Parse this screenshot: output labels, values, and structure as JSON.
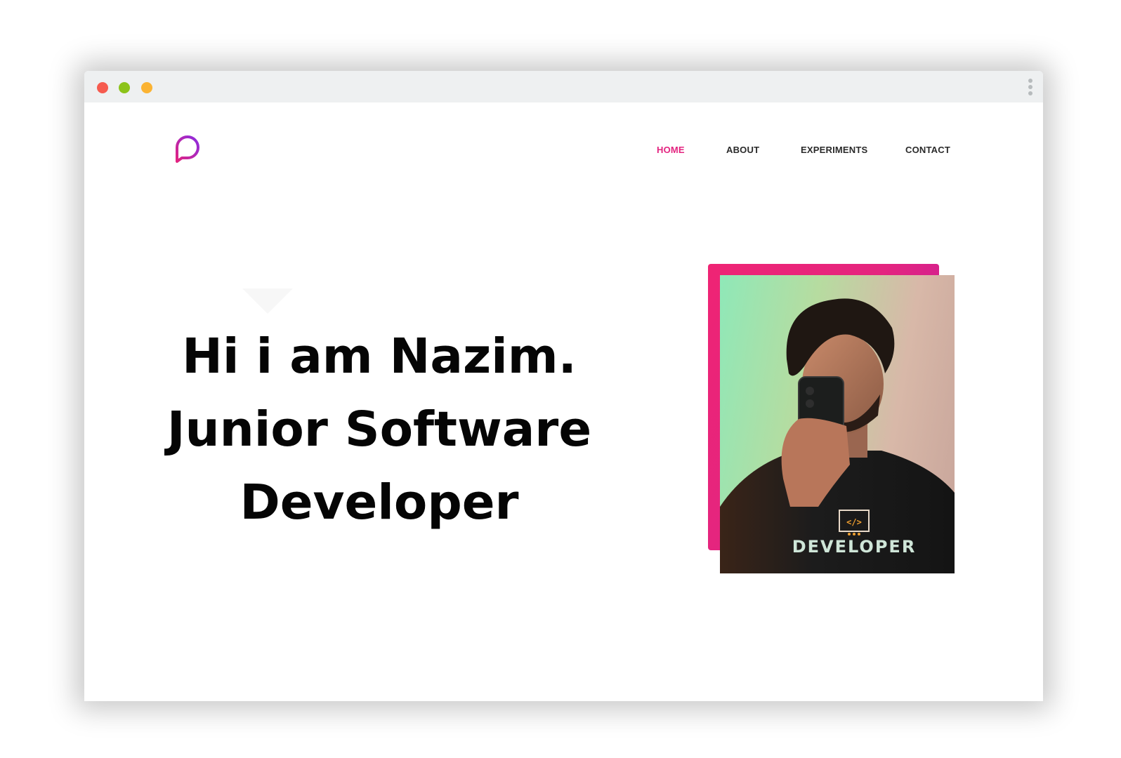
{
  "window": {
    "controls": [
      "close",
      "minimize",
      "maximize"
    ],
    "menu_icon": "kebab-menu-icon"
  },
  "brand": {
    "logo_icon": "speech-bubble-logo-icon",
    "logo_colors": [
      "#e3237f",
      "#8b2be2"
    ]
  },
  "nav": {
    "items": [
      {
        "label": "HOME",
        "active": true
      },
      {
        "label": "ABOUT",
        "active": false
      },
      {
        "label": "EXPERIMENTS",
        "active": false
      },
      {
        "label": "CONTACT",
        "active": false
      }
    ]
  },
  "hero": {
    "lines": [
      "Hi i am Nazim.",
      "Junior Software",
      "Developer"
    ]
  },
  "photo": {
    "shirt_text": "DEVELOPER",
    "shirt_icon": "</>"
  },
  "colors": {
    "accent": "#e3237f",
    "accent_purple": "#b318ae",
    "text": "#050505"
  }
}
